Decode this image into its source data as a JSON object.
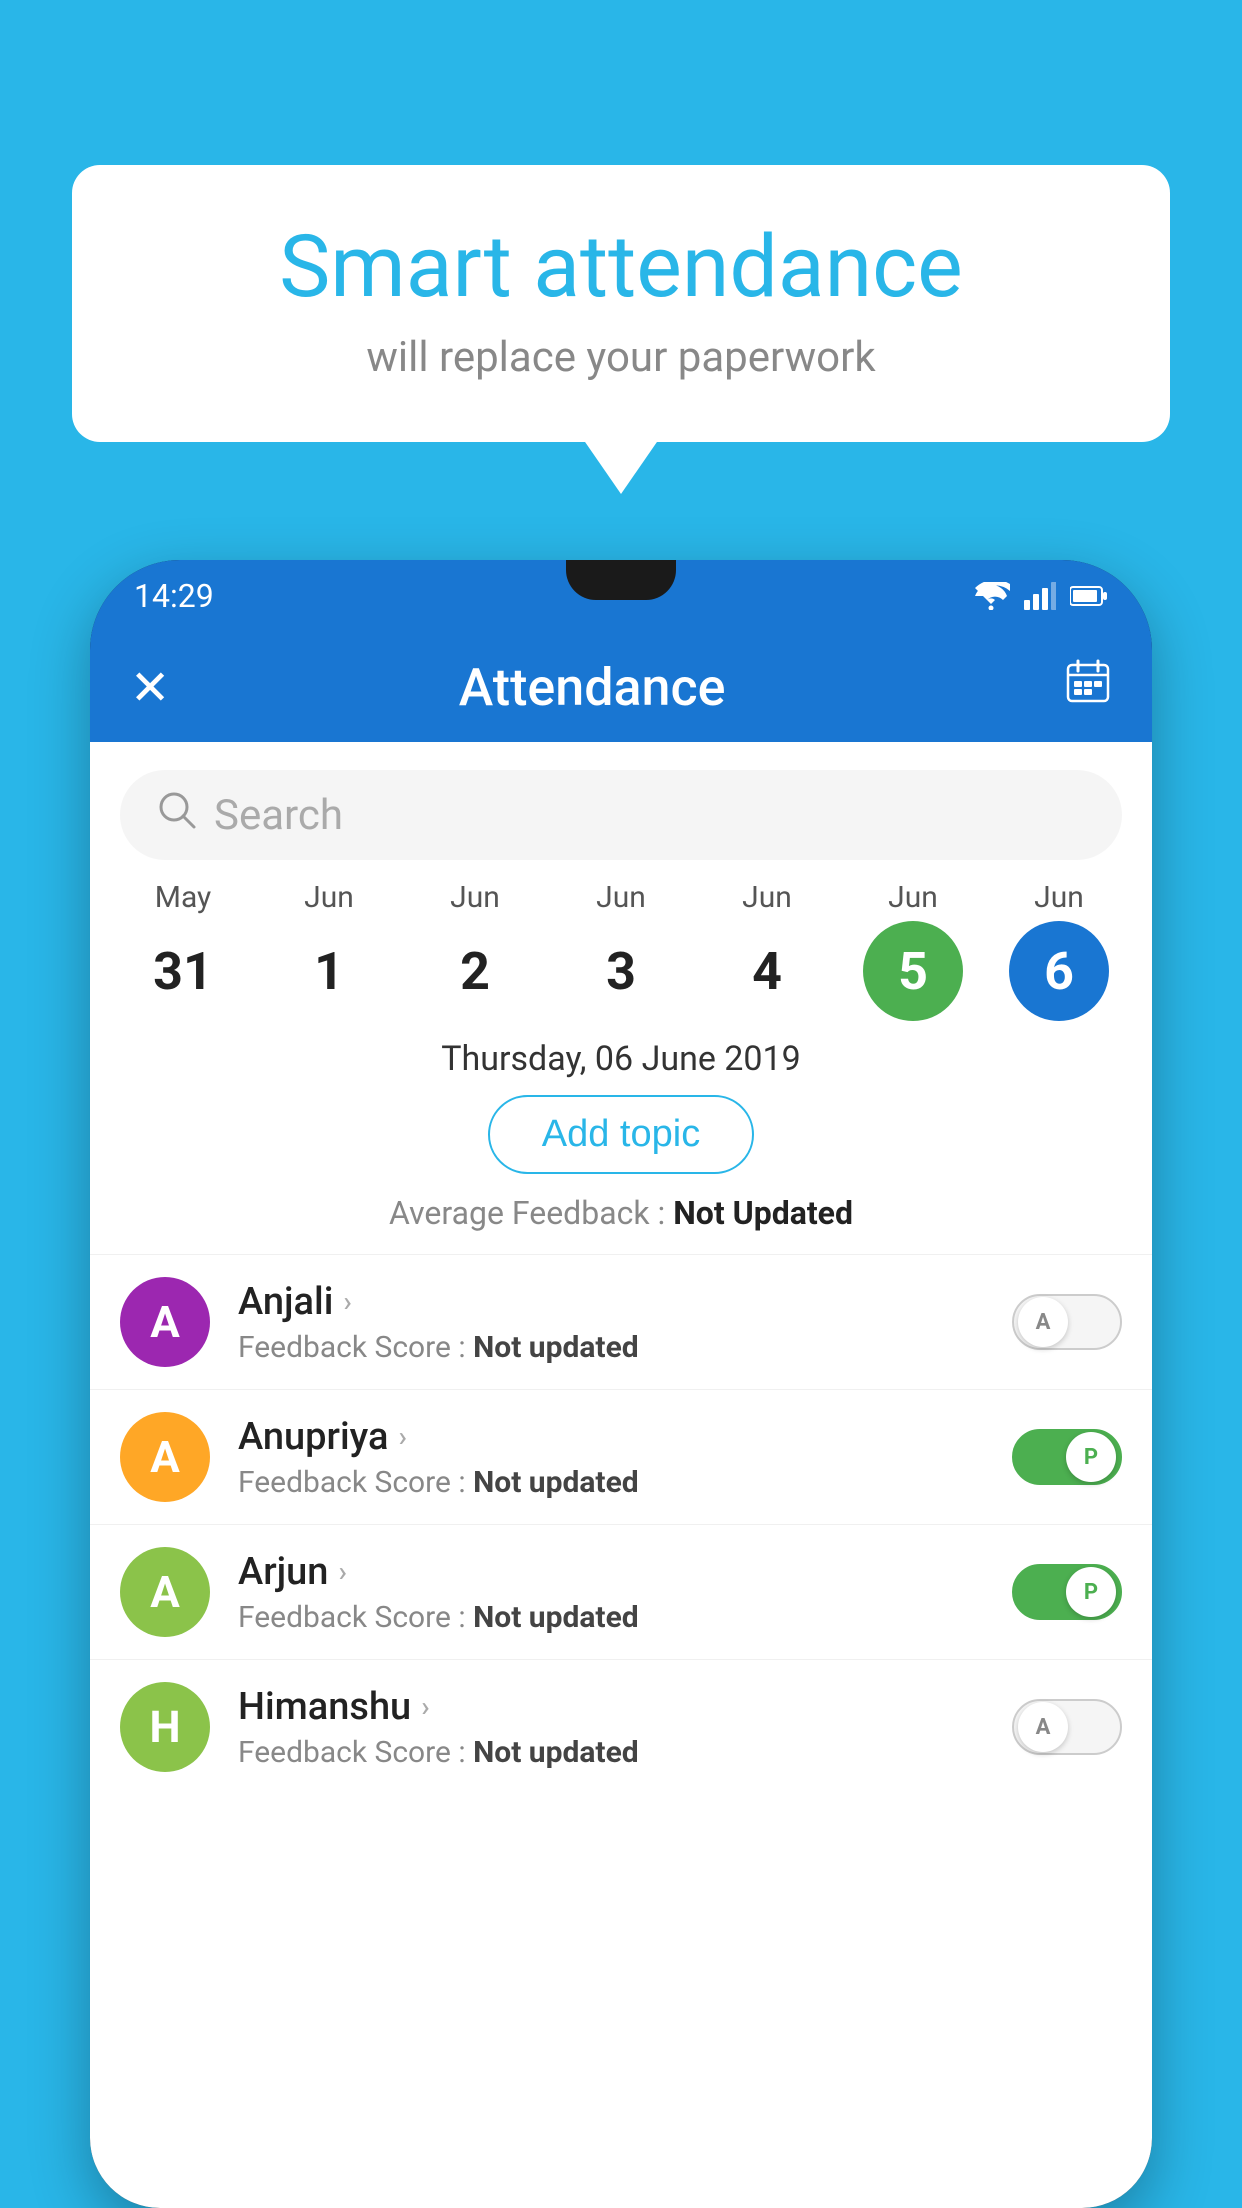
{
  "background_color": "#29B6E8",
  "speech_bubble": {
    "title": "Smart attendance",
    "subtitle": "will replace your paperwork"
  },
  "status_bar": {
    "time": "14:29",
    "icons": [
      "wifi",
      "signal",
      "battery"
    ]
  },
  "app_bar": {
    "close_label": "✕",
    "title": "Attendance",
    "calendar_icon": "📅"
  },
  "search": {
    "placeholder": "Search"
  },
  "calendar": {
    "days": [
      {
        "month": "May",
        "date": "31",
        "style": "normal"
      },
      {
        "month": "Jun",
        "date": "1",
        "style": "normal"
      },
      {
        "month": "Jun",
        "date": "2",
        "style": "normal"
      },
      {
        "month": "Jun",
        "date": "3",
        "style": "normal"
      },
      {
        "month": "Jun",
        "date": "4",
        "style": "normal"
      },
      {
        "month": "Jun",
        "date": "5",
        "style": "green"
      },
      {
        "month": "Jun",
        "date": "6",
        "style": "blue"
      }
    ]
  },
  "selected_date_label": "Thursday, 06 June 2019",
  "add_topic_label": "Add topic",
  "avg_feedback_label": "Average Feedback :",
  "avg_feedback_value": "Not Updated",
  "students": [
    {
      "name": "Anjali",
      "initial": "A",
      "avatar_color": "#9C27B0",
      "feedback_label": "Feedback Score :",
      "feedback_value": "Not updated",
      "toggle_state": "off",
      "toggle_label": "A"
    },
    {
      "name": "Anupriya",
      "initial": "A",
      "avatar_color": "#FFA726",
      "feedback_label": "Feedback Score :",
      "feedback_value": "Not updated",
      "toggle_state": "on",
      "toggle_label": "P"
    },
    {
      "name": "Arjun",
      "initial": "A",
      "avatar_color": "#8BC34A",
      "feedback_label": "Feedback Score :",
      "feedback_value": "Not updated",
      "toggle_state": "on",
      "toggle_label": "P"
    },
    {
      "name": "Himanshu",
      "initial": "H",
      "avatar_color": "#8BC34A",
      "feedback_label": "Feedback Score :",
      "feedback_value": "Not updated",
      "toggle_state": "off",
      "toggle_label": "A"
    }
  ]
}
